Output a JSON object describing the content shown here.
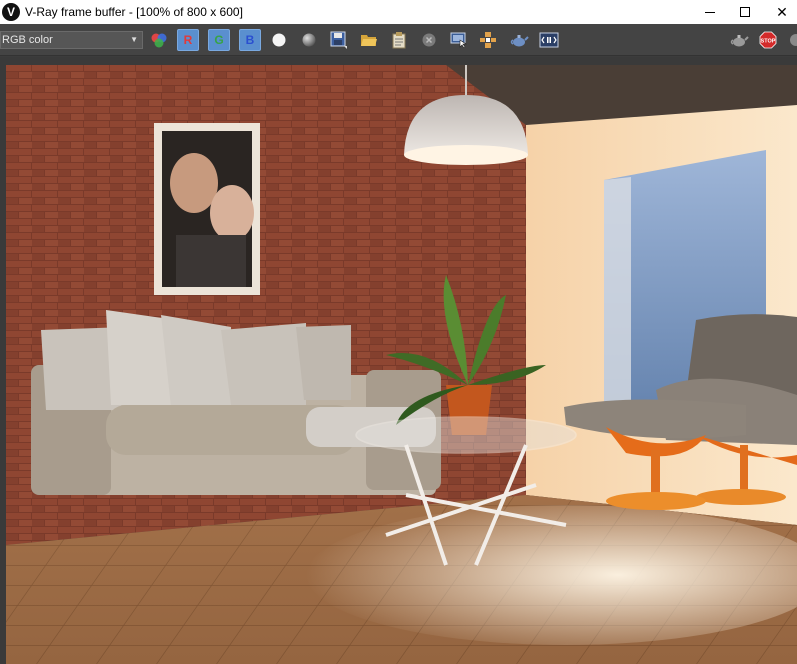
{
  "window": {
    "logo_glyph": "V",
    "title": "V-Ray frame buffer - [100% of 800 x 600]",
    "minimize_icon": "minimize-icon",
    "maximize_icon": "maximize-icon",
    "close_glyph": "✕"
  },
  "toolbar": {
    "channel_value": "RGB color",
    "channel_arrow": "▼",
    "red_label": "R",
    "green_label": "G",
    "blue_label": "B",
    "icons": [
      "color-balls-icon",
      "white-circle-icon",
      "gray-sphere-icon",
      "save-icon",
      "open-folder-icon",
      "clipboard-icon",
      "clear-icon",
      "track-mouse-icon",
      "region-render-icon",
      "teapot-icon",
      "lens-effects-icon",
      "teapot-render-icon",
      "stop-icon"
    ],
    "stop_label": "STOP",
    "accent": "#5a8fcf"
  },
  "render": {
    "description_icon": "rendered-image"
  }
}
